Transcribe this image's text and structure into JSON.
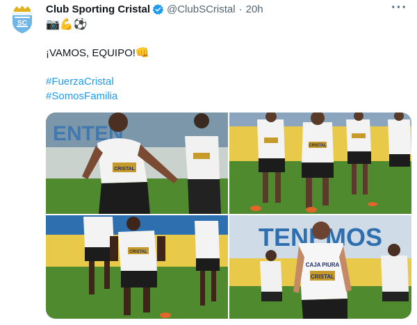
{
  "tweet": {
    "display_name": "Club Sporting Cristal",
    "handle": "@ClubSCristal",
    "separator": "·",
    "time": "20h",
    "more_label": "···",
    "emoji_line": "📷💪⚽",
    "text": "¡VAMOS, EQUIPO!",
    "text_emoji": "👊",
    "hashtags": [
      "#FuerzaCristal",
      "#SomosFamilia"
    ]
  },
  "photos": [
    {
      "banner": "ENTEN",
      "shirt": "CRISTAL"
    },
    {
      "banner": "",
      "shirt": "CRISTAL"
    },
    {
      "banner": "",
      "shirt": "CRISTAL"
    },
    {
      "banner": "TENEMOS",
      "shirt": "CRISTAL",
      "sponsor": "CAJA PIURA"
    }
  ],
  "colors": {
    "accent": "#1d9bf0",
    "grass": "#4f8b2e",
    "wall_blue": "#2e6fb0",
    "wall_yellow": "#e8c94a"
  }
}
